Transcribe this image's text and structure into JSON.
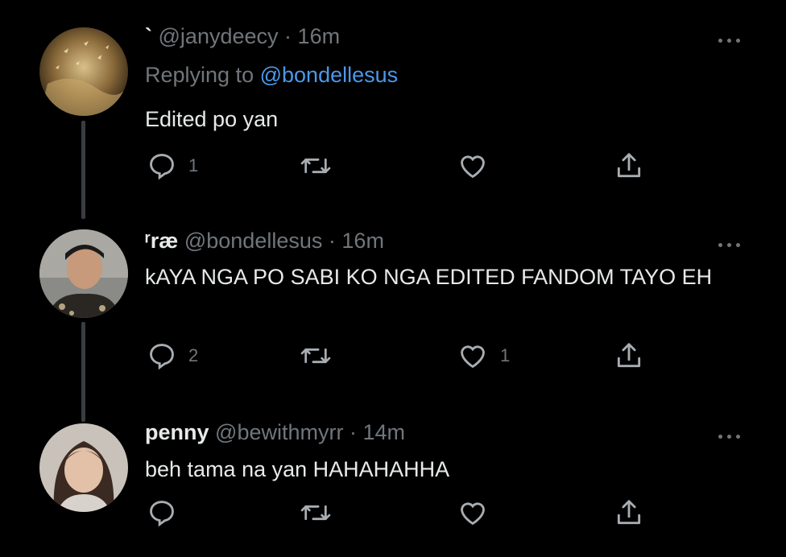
{
  "tweets": [
    {
      "name": "`",
      "handle": "@janydeecy",
      "separator": "·",
      "time": "16m",
      "replying_prefix": "Replying to",
      "replying_handle": "@bondellesus",
      "text": "Edited po yan",
      "reply_count": "1",
      "retweet_count": "",
      "like_count": ""
    },
    {
      "name": "ʳræ",
      "handle": "@bondellesus",
      "separator": "·",
      "time": "16m",
      "text": "kAYA NGA PO SABI KO NGA EDITED FANDOM TAYO EH",
      "reply_count": "2",
      "retweet_count": "",
      "like_count": "1"
    },
    {
      "name": "penny",
      "handle": "@bewithmyrr",
      "separator": "·",
      "time": "14m",
      "text": "beh tama na yan HAHAHAHHA",
      "reply_count": "",
      "retweet_count": "",
      "like_count": ""
    }
  ],
  "icons": {
    "reply": "reply-icon",
    "retweet": "retweet-icon",
    "like": "heart-icon",
    "share": "share-icon",
    "more": "more-icon"
  },
  "colors": {
    "background": "#000000",
    "text": "#e7e9ea",
    "muted": "#71767b",
    "link": "#4a99e9"
  }
}
